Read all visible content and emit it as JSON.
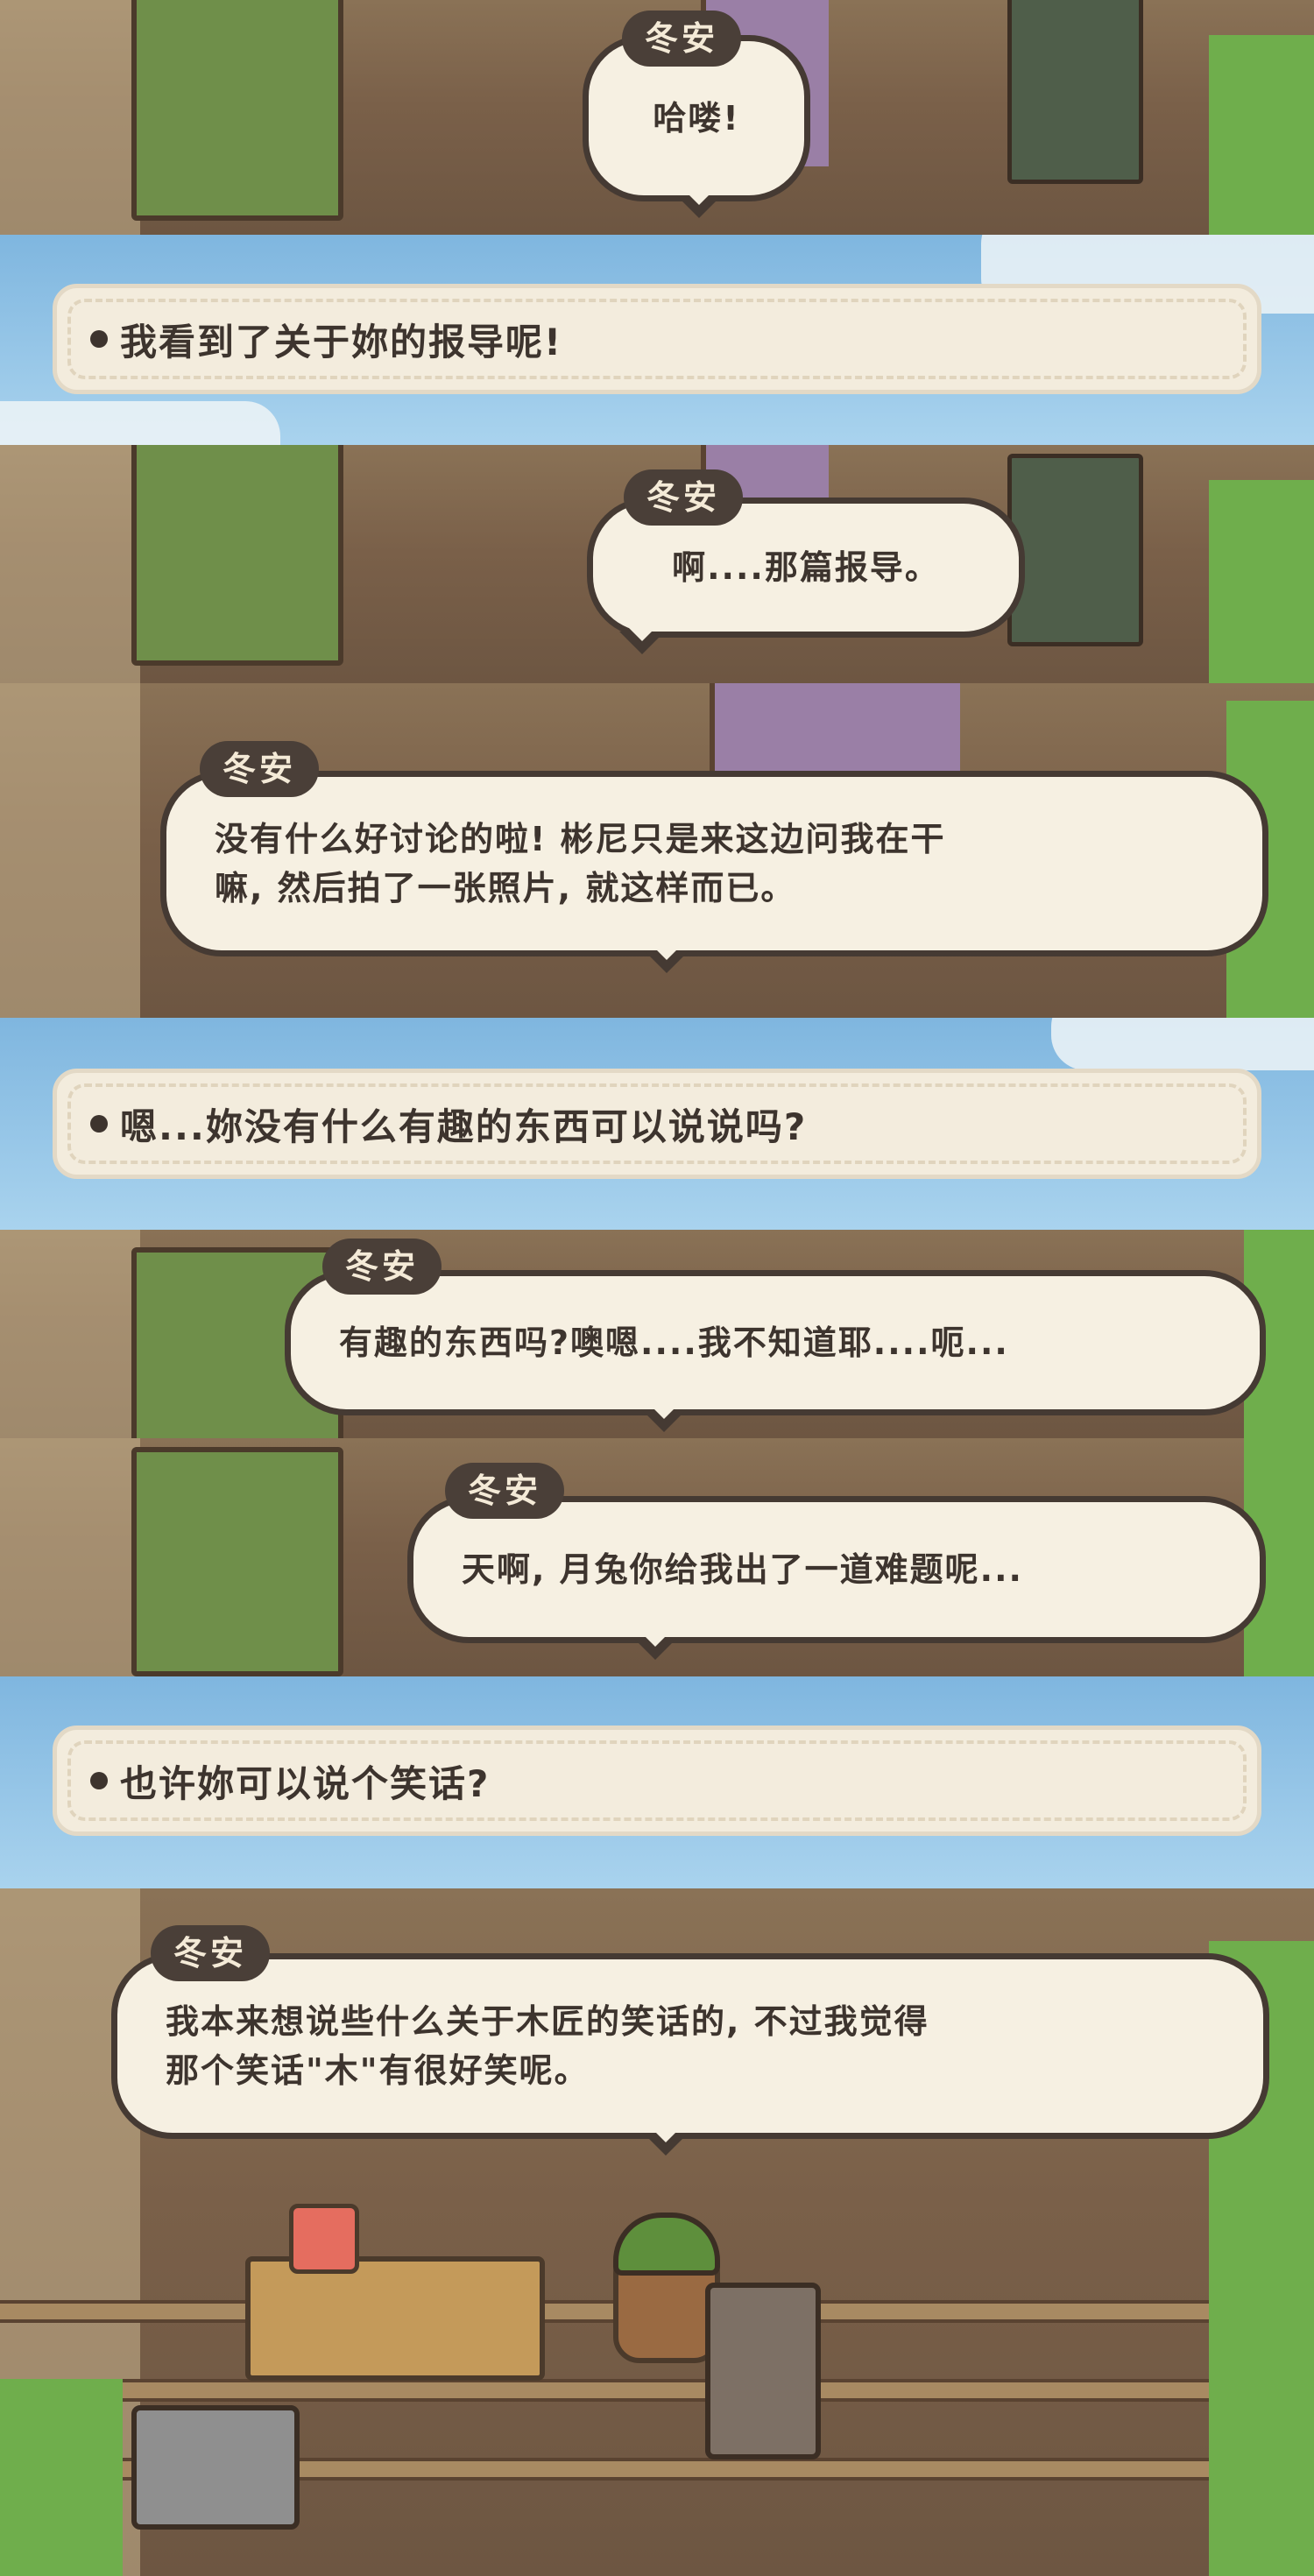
{
  "speaker": "冬安",
  "frames": [
    {
      "type": "dialogue",
      "speaker": "冬安",
      "text_lines": [
        "哈喽!"
      ]
    },
    {
      "type": "choice",
      "text": "我看到了关于妳的报导呢!"
    },
    {
      "type": "dialogue",
      "speaker": "冬安",
      "text_lines": [
        "啊....那篇报导。"
      ]
    },
    {
      "type": "dialogue",
      "speaker": "冬安",
      "text_lines": [
        "没有什么好讨论的啦! 彬尼只是来这边问我在干",
        "嘛, 然后拍了一张照片, 就这样而已。"
      ]
    },
    {
      "type": "choice",
      "text": "嗯...妳没有什么有趣的东西可以说说吗?"
    },
    {
      "type": "dialogue",
      "speaker": "冬安",
      "text_lines": [
        "有趣的东西吗?噢嗯....我不知道耶....呃..."
      ]
    },
    {
      "type": "dialogue",
      "speaker": "冬安",
      "text_lines": [
        "天啊, 月兔你给我出了一道难题呢..."
      ]
    },
    {
      "type": "choice",
      "text": "也许妳可以说个笑话?"
    },
    {
      "type": "dialogue",
      "speaker": "冬安",
      "text_lines": [
        "我本来想说些什么关于木匠的笑话的, 不过我觉得",
        "那个笑话\"木\"有很好笑呢。"
      ]
    }
  ],
  "colors": {
    "bubble_fill": "#f6f0e2",
    "bubble_border": "#453a33",
    "name_tag": "#4a3f38",
    "sky": "#7fb6df",
    "choice_fill": "#f3ecdd"
  }
}
